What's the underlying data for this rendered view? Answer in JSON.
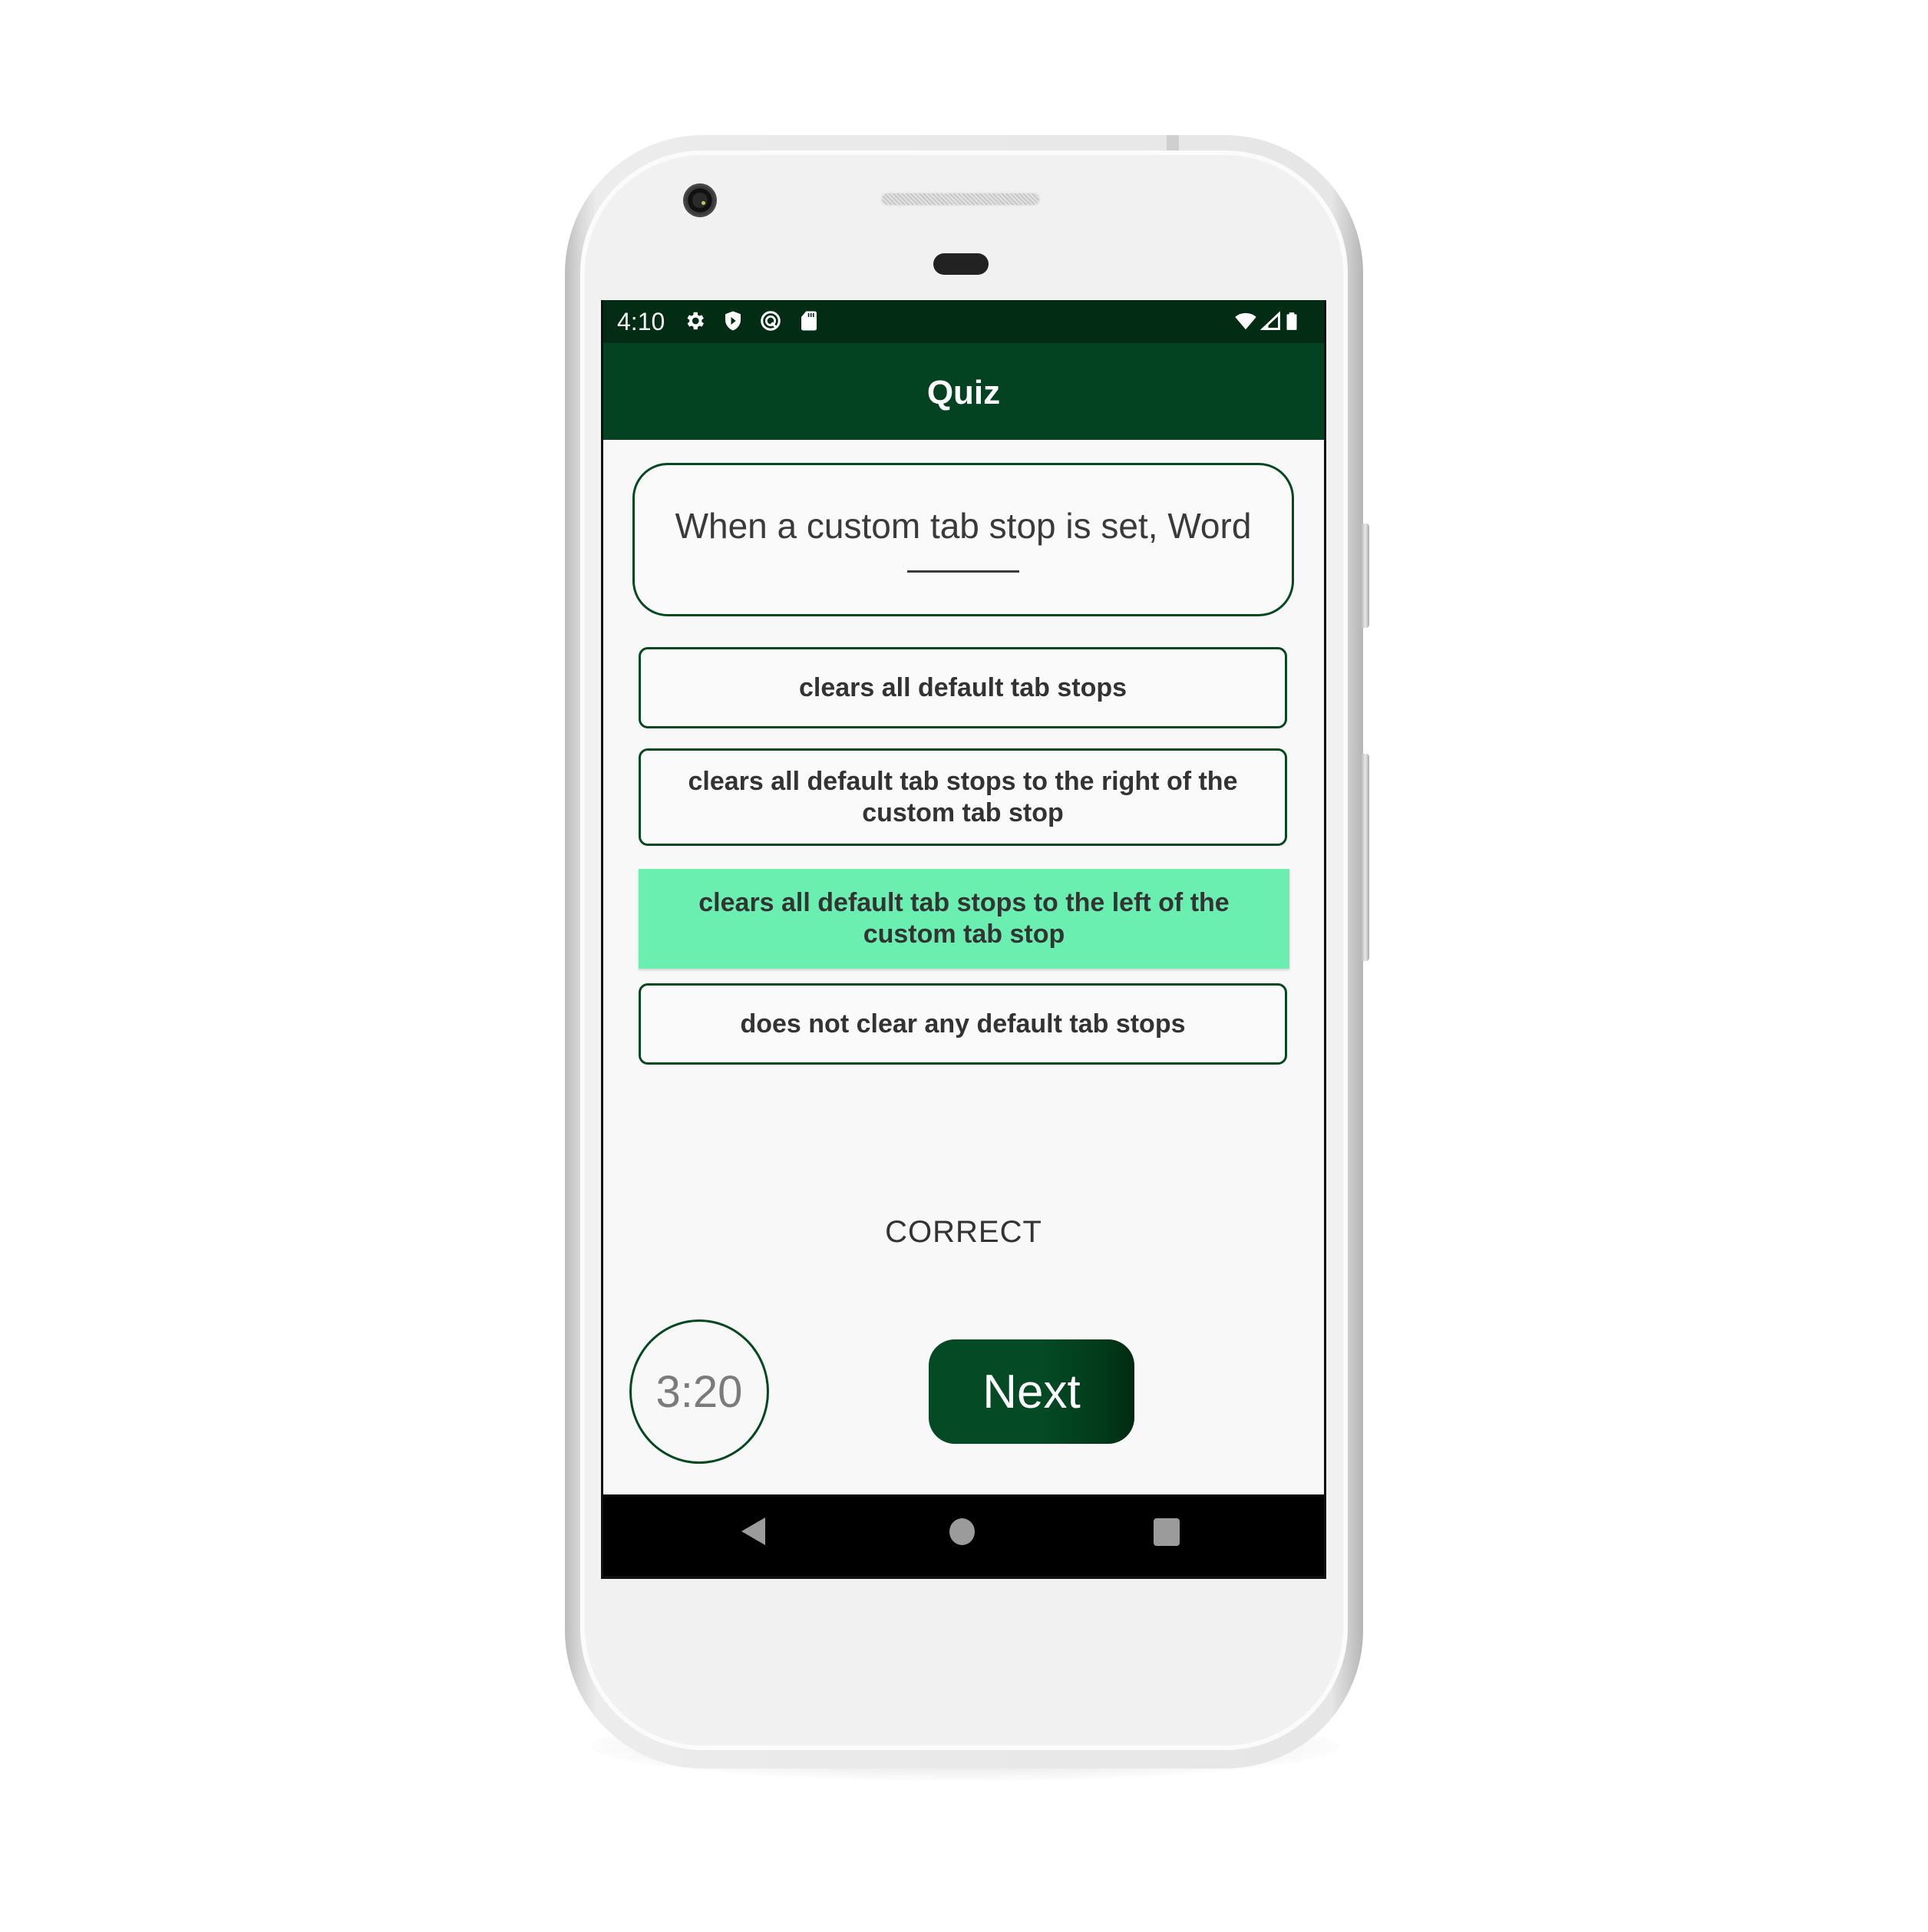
{
  "status_bar": {
    "time": "4:10",
    "left_icons": [
      "settings-icon",
      "play-protect-shield-icon",
      "at-sign-icon",
      "sd-card-icon"
    ],
    "right_icons": [
      "wifi-icon",
      "cellular-signal-icon",
      "battery-icon"
    ]
  },
  "app_bar": {
    "title": "Quiz"
  },
  "question": {
    "text": "When a custom tab stop is set, Word",
    "blank": "_______"
  },
  "options": [
    {
      "label": "clears all default tab stops",
      "selected": false
    },
    {
      "label": "clears all default tab stops to the right of the custom tab stop",
      "selected": false
    },
    {
      "label": "clears all default tab stops to the left of the custom tab stop",
      "selected": true
    },
    {
      "label": "does not clear any default tab stops",
      "selected": false
    }
  ],
  "result": "CORRECT",
  "timer": "3:20",
  "next_button": "Next",
  "nav_bar": {
    "icons": [
      "back-icon",
      "home-icon",
      "recents-icon"
    ]
  },
  "colors": {
    "status_bar": "#032c15",
    "app_bar": "#044321",
    "accent_border": "#06481f",
    "selected_option": "#6aefb0",
    "next_button": "#044a24"
  }
}
